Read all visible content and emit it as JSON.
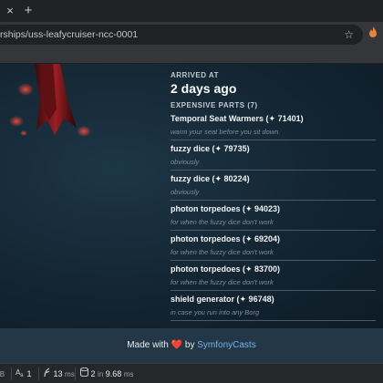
{
  "browser": {
    "tab_close_glyph": "×",
    "new_tab_glyph": "+",
    "url": "rships/uss-leafycruiser-ncc-0001",
    "star_glyph": "☆"
  },
  "ship": {
    "arrived_label": "ARRIVED AT",
    "arrived_value": "2 days ago",
    "parts_label": "EXPENSIVE PARTS (7)",
    "parts": [
      {
        "name": "Temporal Seat Warmers (✦ 71401)",
        "desc": "warm your seat before you sit down"
      },
      {
        "name": "fuzzy dice (✦ 79735)",
        "desc": "obviously"
      },
      {
        "name": "fuzzy dice (✦ 80224)",
        "desc": "obviously"
      },
      {
        "name": "photon torpedoes (✦ 94023)",
        "desc": "for when the fuzzy dice don't work"
      },
      {
        "name": "photon torpedoes (✦ 69204)",
        "desc": "for when the fuzzy dice don't work"
      },
      {
        "name": "photon torpedoes (✦ 83700)",
        "desc": "for when the fuzzy dice don't work"
      },
      {
        "name": "shield generator (✦ 96748)",
        "desc": "in case you run into any Borg"
      }
    ]
  },
  "footer": {
    "prefix": "Made with",
    "heart": "❤️",
    "suffix": "by",
    "brand": "SymfonyCasts"
  },
  "debugbar": {
    "memory_unit": "iB",
    "translations": "1",
    "time_value": "13",
    "time_unit": "ms",
    "db_queries": "2",
    "db_in": "in",
    "db_time": "9.68",
    "db_unit": "ms"
  },
  "colors": {
    "heart": "#e0245e",
    "link": "#6fb3ee",
    "page_bg": "#132532"
  }
}
